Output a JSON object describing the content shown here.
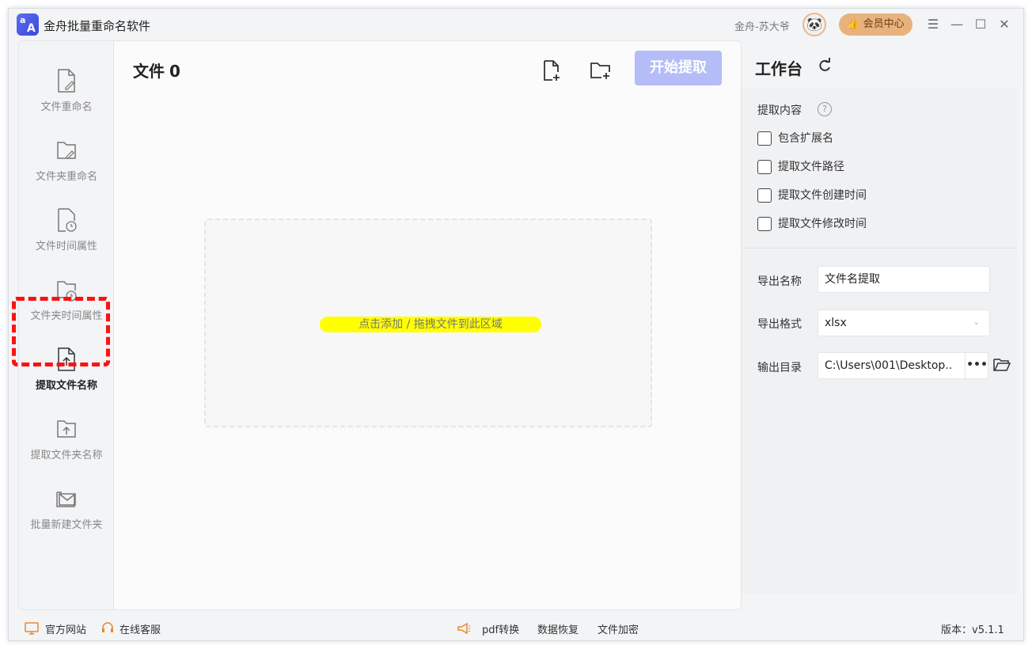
{
  "app": {
    "title": "金舟批量重命名软件",
    "logo_top": "a",
    "logo_bottom": "A",
    "user_name": "金舟-苏大爷",
    "vip_label": "会员中心"
  },
  "sidebar": {
    "items": [
      {
        "label": "文件重命名",
        "icon": "file-edit-icon"
      },
      {
        "label": "文件夹重命名",
        "icon": "folder-edit-icon"
      },
      {
        "label": "文件时间属性",
        "icon": "file-clock-icon"
      },
      {
        "label": "文件夹时间属性",
        "icon": "folder-clock-icon"
      },
      {
        "label": "提取文件名称",
        "icon": "file-upload-icon",
        "active": true
      },
      {
        "label": "提取文件夹名称",
        "icon": "folder-upload-icon"
      },
      {
        "label": "批量新建文件夹",
        "icon": "folder-mail-icon"
      }
    ]
  },
  "main": {
    "file_label": "文件",
    "file_count": "0",
    "start_button": "开始提取",
    "drop_hint": "点击添加 / 拖拽文件到此区域"
  },
  "workbench": {
    "title": "工作台",
    "extract_title": "提取内容",
    "options": [
      {
        "label": "包含扩展名",
        "checked": false
      },
      {
        "label": "提取文件路径",
        "checked": false
      },
      {
        "label": "提取文件创建时间",
        "checked": false
      },
      {
        "label": "提取文件修改时间",
        "checked": false
      }
    ],
    "export_name_label": "导出名称",
    "export_name_value": "文件名提取",
    "export_format_label": "导出格式",
    "export_format_value": "xlsx",
    "output_dir_label": "输出目录",
    "output_dir_value": "C:\\Users\\001\\Desktop..",
    "more_label": "•••"
  },
  "footer": {
    "website": "官方网站",
    "support": "在线客服",
    "pdf": "pdf转换",
    "recovery": "数据恢复",
    "encrypt": "文件加密",
    "version": "版本：v5.1.1"
  },
  "colors": {
    "accent": "#b4bdf7",
    "highlight_box": "#ff1010",
    "drop_highlight": "#ffff00",
    "vip": "#e8b27d"
  }
}
